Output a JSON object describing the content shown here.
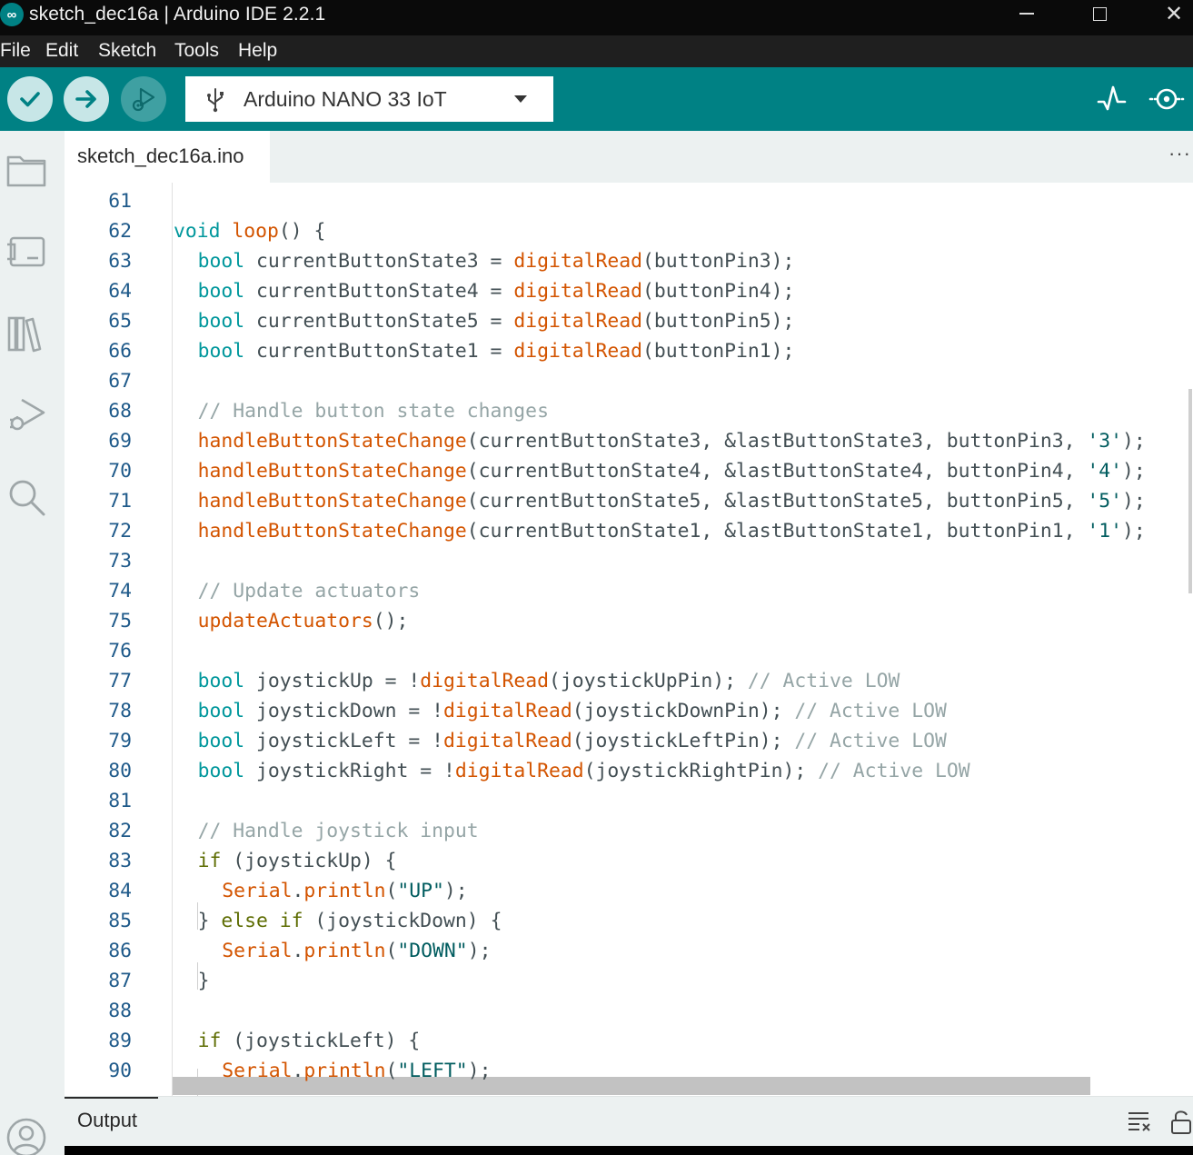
{
  "window": {
    "title": "sketch_dec16a | Arduino IDE 2.2.1",
    "logo_glyph": "∞",
    "controls": {
      "close": "✕"
    }
  },
  "menu": [
    "File",
    "Edit",
    "Sketch",
    "Tools",
    "Help"
  ],
  "toolbar": {
    "verify_icon": "check-icon",
    "upload_icon": "arrow-right-icon",
    "debug_icon": "debug-icon",
    "board": "Arduino NANO 33 IoT",
    "right_icons": [
      "serial-plotter-icon",
      "serial-monitor-icon"
    ]
  },
  "sidebar": [
    "sketchbook-icon",
    "boards-manager-icon",
    "library-manager-icon",
    "debug-icon",
    "search-icon",
    "account-icon"
  ],
  "tabs": [
    {
      "label": "sketch_dec16a.ino",
      "active": true
    }
  ],
  "tab_more": "···",
  "editor": {
    "lines": [
      {
        "n": "61",
        "indent": 0,
        "tokens": []
      },
      {
        "n": "62",
        "indent": 0,
        "tokens": [
          [
            "kw",
            "void"
          ],
          [
            "id",
            " "
          ],
          [
            "fn",
            "loop"
          ],
          [
            "id",
            "() {"
          ]
        ]
      },
      {
        "n": "63",
        "indent": 1,
        "tokens": [
          [
            "kw",
            "bool"
          ],
          [
            "id",
            " currentButtonState3 = "
          ],
          [
            "fn",
            "digitalRead"
          ],
          [
            "id",
            "(buttonPin3);"
          ]
        ]
      },
      {
        "n": "64",
        "indent": 1,
        "tokens": [
          [
            "kw",
            "bool"
          ],
          [
            "id",
            " currentButtonState4 = "
          ],
          [
            "fn",
            "digitalRead"
          ],
          [
            "id",
            "(buttonPin4);"
          ]
        ]
      },
      {
        "n": "65",
        "indent": 1,
        "tokens": [
          [
            "kw",
            "bool"
          ],
          [
            "id",
            " currentButtonState5 = "
          ],
          [
            "fn",
            "digitalRead"
          ],
          [
            "id",
            "(buttonPin5);"
          ]
        ]
      },
      {
        "n": "66",
        "indent": 1,
        "tokens": [
          [
            "kw",
            "bool"
          ],
          [
            "id",
            " currentButtonState1 = "
          ],
          [
            "fn",
            "digitalRead"
          ],
          [
            "id",
            "(buttonPin1);"
          ]
        ]
      },
      {
        "n": "67",
        "indent": 0,
        "tokens": []
      },
      {
        "n": "68",
        "indent": 1,
        "tokens": [
          [
            "cm",
            "// Handle button state changes"
          ]
        ]
      },
      {
        "n": "69",
        "indent": 1,
        "tokens": [
          [
            "fn",
            "handleButtonStateChange"
          ],
          [
            "id",
            "(currentButtonState3, &lastButtonState3, buttonPin3, "
          ],
          [
            "str",
            "'3'"
          ],
          [
            "id",
            ");"
          ]
        ]
      },
      {
        "n": "70",
        "indent": 1,
        "tokens": [
          [
            "fn",
            "handleButtonStateChange"
          ],
          [
            "id",
            "(currentButtonState4, &lastButtonState4, buttonPin4, "
          ],
          [
            "str",
            "'4'"
          ],
          [
            "id",
            ");"
          ]
        ]
      },
      {
        "n": "71",
        "indent": 1,
        "tokens": [
          [
            "fn",
            "handleButtonStateChange"
          ],
          [
            "id",
            "(currentButtonState5, &lastButtonState5, buttonPin5, "
          ],
          [
            "str",
            "'5'"
          ],
          [
            "id",
            ");"
          ]
        ]
      },
      {
        "n": "72",
        "indent": 1,
        "tokens": [
          [
            "fn",
            "handleButtonStateChange"
          ],
          [
            "id",
            "(currentButtonState1, &lastButtonState1, buttonPin1, "
          ],
          [
            "str",
            "'1'"
          ],
          [
            "id",
            ");"
          ]
        ]
      },
      {
        "n": "73",
        "indent": 0,
        "tokens": []
      },
      {
        "n": "74",
        "indent": 1,
        "tokens": [
          [
            "cm",
            "// Update actuators"
          ]
        ]
      },
      {
        "n": "75",
        "indent": 1,
        "tokens": [
          [
            "fn",
            "updateActuators"
          ],
          [
            "id",
            "();"
          ]
        ]
      },
      {
        "n": "76",
        "indent": 0,
        "tokens": []
      },
      {
        "n": "77",
        "indent": 1,
        "tokens": [
          [
            "kw",
            "bool"
          ],
          [
            "id",
            " joystickUp = !"
          ],
          [
            "fn",
            "digitalRead"
          ],
          [
            "id",
            "(joystickUpPin); "
          ],
          [
            "cm",
            "// Active LOW"
          ]
        ]
      },
      {
        "n": "78",
        "indent": 1,
        "tokens": [
          [
            "kw",
            "bool"
          ],
          [
            "id",
            " joystickDown = !"
          ],
          [
            "fn",
            "digitalRead"
          ],
          [
            "id",
            "(joystickDownPin); "
          ],
          [
            "cm",
            "// Active LOW"
          ]
        ]
      },
      {
        "n": "79",
        "indent": 1,
        "tokens": [
          [
            "kw",
            "bool"
          ],
          [
            "id",
            " joystickLeft = !"
          ],
          [
            "fn",
            "digitalRead"
          ],
          [
            "id",
            "(joystickLeftPin); "
          ],
          [
            "cm",
            "// Active LOW"
          ]
        ]
      },
      {
        "n": "80",
        "indent": 1,
        "tokens": [
          [
            "kw",
            "bool"
          ],
          [
            "id",
            " joystickRight = !"
          ],
          [
            "fn",
            "digitalRead"
          ],
          [
            "id",
            "(joystickRightPin); "
          ],
          [
            "cm",
            "// Active LOW"
          ]
        ]
      },
      {
        "n": "81",
        "indent": 0,
        "tokens": []
      },
      {
        "n": "82",
        "indent": 1,
        "tokens": [
          [
            "cm",
            "// Handle joystick input"
          ]
        ]
      },
      {
        "n": "83",
        "indent": 1,
        "tokens": [
          [
            "ctl",
            "if"
          ],
          [
            "id",
            " (joystickUp) {"
          ]
        ]
      },
      {
        "n": "84",
        "indent": 2,
        "tokens": [
          [
            "fn",
            "Serial"
          ],
          [
            "id",
            "."
          ],
          [
            "fn",
            "println"
          ],
          [
            "id",
            "("
          ],
          [
            "str",
            "\"UP\""
          ],
          [
            "id",
            ");"
          ]
        ]
      },
      {
        "n": "85",
        "indent": 1,
        "tokens": [
          [
            "id",
            "} "
          ],
          [
            "ctl",
            "else if"
          ],
          [
            "id",
            " (joystickDown) {"
          ]
        ]
      },
      {
        "n": "86",
        "indent": 2,
        "tokens": [
          [
            "fn",
            "Serial"
          ],
          [
            "id",
            "."
          ],
          [
            "fn",
            "println"
          ],
          [
            "id",
            "("
          ],
          [
            "str",
            "\"DOWN\""
          ],
          [
            "id",
            ");"
          ]
        ]
      },
      {
        "n": "87",
        "indent": 1,
        "tokens": [
          [
            "id",
            "}"
          ]
        ]
      },
      {
        "n": "88",
        "indent": 0,
        "tokens": []
      },
      {
        "n": "89",
        "indent": 1,
        "tokens": [
          [
            "ctl",
            "if"
          ],
          [
            "id",
            " (joystickLeft) {"
          ]
        ]
      },
      {
        "n": "90",
        "indent": 2,
        "tokens": [
          [
            "fn",
            "Serial"
          ],
          [
            "id",
            "."
          ],
          [
            "fn",
            "println"
          ],
          [
            "id",
            "("
          ],
          [
            "str",
            "\"LEFT\""
          ],
          [
            "id",
            ");"
          ]
        ]
      }
    ]
  },
  "output": {
    "label": "Output",
    "icons": [
      "clear-output-icon",
      "scroll-lock-icon"
    ]
  },
  "colors": {
    "accent": "#008184",
    "keyword": "#00979c",
    "function": "#d35400",
    "control": "#5e6d03",
    "comment": "#95a5a6",
    "string": "#005c5f"
  }
}
